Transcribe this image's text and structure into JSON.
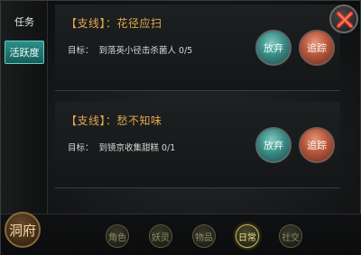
{
  "left_tabs": [
    {
      "label": "任务"
    },
    {
      "label": "活跃度"
    }
  ],
  "quests": [
    {
      "title": "【支线】：花径应扫",
      "target_label": "目标：",
      "target_text": "到落英小径击杀菌人 0/5",
      "abandon_label": "放弃",
      "track_label": "追踪"
    },
    {
      "title": "【支线】：愁不知味",
      "target_label": "目标：",
      "target_text": "到镜京收集甜糕 0/1",
      "abandon_label": "放弃",
      "track_label": "追踪"
    }
  ],
  "bottom_nav": {
    "home_label": "洞府",
    "items": [
      {
        "label": "角色"
      },
      {
        "label": "妖灵"
      },
      {
        "label": "物品"
      },
      {
        "label": "日常"
      },
      {
        "label": "社交"
      }
    ],
    "active_item": "日常"
  },
  "colors": {
    "quest_title": "#e0a84c",
    "abandon_button": "#3b8c86",
    "track_button": "#b5573c",
    "active_tab": "#2c8f8a",
    "active_nav": "#c8b45a"
  },
  "icons": {
    "close": "close-icon"
  }
}
